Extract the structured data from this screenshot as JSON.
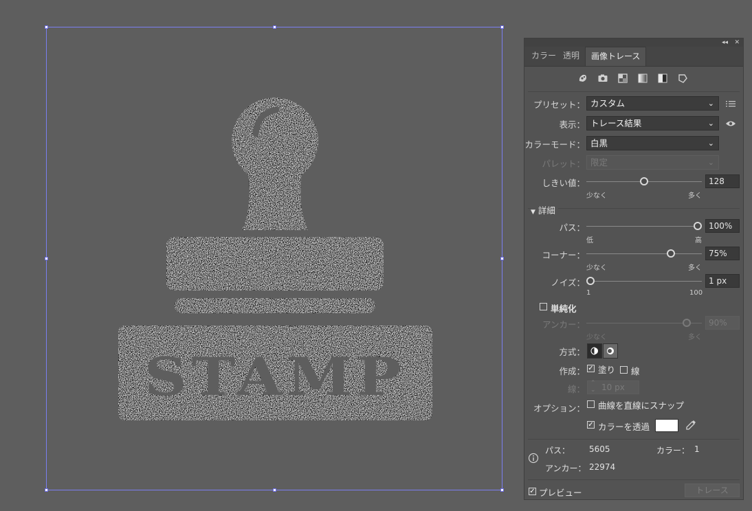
{
  "artwork": {
    "stamp_text": "STAMP"
  },
  "panel": {
    "tabs": [
      {
        "label": "カラー",
        "active": false
      },
      {
        "label": "透明",
        "active": false
      },
      {
        "label": "画像トレース",
        "active": true
      }
    ],
    "top_controls": {
      "collapse": "◂◂",
      "close": "✕"
    },
    "preset_icons": [
      "auto-color-icon",
      "high-color-icon",
      "low-color-icon",
      "grayscale-icon",
      "black-white-icon",
      "outline-icon"
    ],
    "preset": {
      "label": "プリセット：",
      "value": "カスタム"
    },
    "view": {
      "label": "表示：",
      "value": "トレース結果"
    },
    "color_mode": {
      "label": "カラーモード：",
      "value": "白黒"
    },
    "palette": {
      "label": "パレット：",
      "value": "限定"
    },
    "threshold": {
      "label": "しきい値：",
      "value": "128",
      "fraction": 0.5,
      "min_label": "少なく",
      "max_label": "多く"
    },
    "advanced": {
      "label": "詳細"
    },
    "paths": {
      "label": "パス：",
      "value": "100%",
      "fraction": 1.0,
      "min_label": "低",
      "max_label": "高"
    },
    "corners": {
      "label": "コーナー：",
      "value": "75%",
      "fraction": 0.75,
      "min_label": "少なく",
      "max_label": "多く"
    },
    "noise": {
      "label": "ノイズ：",
      "value": "1 px",
      "fraction": 0.0,
      "min_label": "1",
      "max_label": "100"
    },
    "simplify": {
      "label": "単純化",
      "checked": false
    },
    "anchors": {
      "label": "アンカー：",
      "value": "90%",
      "fraction": 0.9,
      "min_label": "少なく",
      "max_label": "多く"
    },
    "method": {
      "label": "方式："
    },
    "create": {
      "label": "作成：",
      "fill_label": "塗り",
      "fill_checked": true,
      "stroke_label": "線",
      "stroke_checked": false
    },
    "stroke": {
      "label": "線：",
      "value": "10 px"
    },
    "options": {
      "label": "オプション：",
      "snap_label": "曲線を直線にスナップ",
      "snap_checked": false,
      "ignore_white_label": "カラーを透過",
      "ignore_white_checked": true,
      "swatch_color": "#ffffff"
    },
    "info": {
      "paths_label": "パス：",
      "paths_value": "5605",
      "colors_label": "カラー：",
      "colors_value": "1",
      "anchors_label": "アンカー：",
      "anchors_value": "22974"
    },
    "preview": {
      "label": "プレビュー",
      "checked": true
    },
    "trace_button": "トレース"
  }
}
